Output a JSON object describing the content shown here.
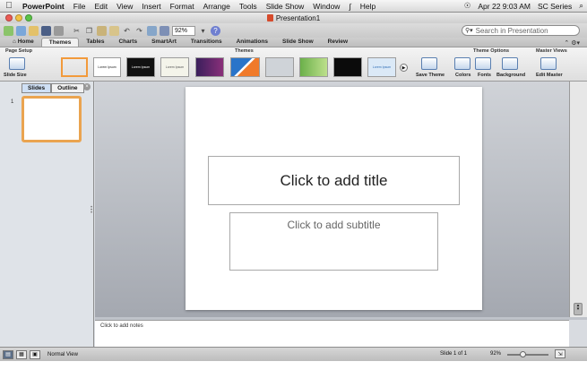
{
  "menubar": {
    "apple": "",
    "app_name": "PowerPoint",
    "items": [
      "File",
      "Edit",
      "View",
      "Insert",
      "Format",
      "Arrange",
      "Tools",
      "Slide Show",
      "Window"
    ],
    "script_icon": "script-menu-icon",
    "help": "Help",
    "datetime": "Apr 22  9:03 AM",
    "user": "SC Series",
    "spotlight_icon": "spotlight-icon"
  },
  "window": {
    "title": "Presentation1"
  },
  "toolbar": {
    "zoom": "92%",
    "search_placeholder": "Search in Presentation"
  },
  "ribbon_tabs": {
    "items": [
      "Home",
      "Themes",
      "Tables",
      "Charts",
      "SmartArt",
      "Transitions",
      "Animations",
      "Slide Show",
      "Review"
    ],
    "active": "Themes"
  },
  "ribbon": {
    "page_setup": {
      "group_label": "Page Setup",
      "slide_size": "Slide Size"
    },
    "themes": {
      "group_label": "Themes",
      "thumbnails": [
        {
          "text": "",
          "bg": "#ffffff",
          "fg": "#333333"
        },
        {
          "text": "Lorem Ipsum",
          "bg": "#ffffff",
          "fg": "#222222"
        },
        {
          "text": "Lorem Ipsum",
          "bg": "#111111",
          "fg": "#ffffff"
        },
        {
          "text": "Lorem Ipsum",
          "bg": "#f4f4ea",
          "fg": "#555555"
        },
        {
          "text": "",
          "bg": "#3a1f5c",
          "fg": "#ffffff"
        },
        {
          "text": "",
          "bg": "#2a74c9",
          "fg": "#ffffff"
        },
        {
          "text": "",
          "bg": "#cfd3d8",
          "fg": "#333333"
        },
        {
          "text": "",
          "bg": "#6bb04a",
          "fg": "#ffffff"
        },
        {
          "text": "",
          "bg": "#0b0b0b",
          "fg": "#ffffff"
        },
        {
          "text": "Lorem Ipsum",
          "bg": "#dbe9f7",
          "fg": "#2f6db5"
        }
      ],
      "save_theme": "Save Theme"
    },
    "theme_options": {
      "group_label": "Theme Options",
      "colors": "Colors",
      "fonts": "Fonts",
      "background": "Background"
    },
    "master_views": {
      "group_label": "Master Views",
      "edit_master": "Edit Master"
    }
  },
  "left_pane": {
    "tabs": [
      "Slides",
      "Outline"
    ],
    "active_tab": "Slides",
    "slide_number": "1"
  },
  "slide": {
    "title_placeholder": "Click to add title",
    "subtitle_placeholder": "Click to add subtitle"
  },
  "notes": {
    "placeholder": "Click to add notes"
  },
  "statusbar": {
    "view_name": "Normal View",
    "slide_count": "Slide 1 of 1",
    "zoom": "92%",
    "zoom_fraction": 0.35
  },
  "colors": {
    "selection_orange": "#f29a3b",
    "accent_blue": "#5a7fb0"
  }
}
